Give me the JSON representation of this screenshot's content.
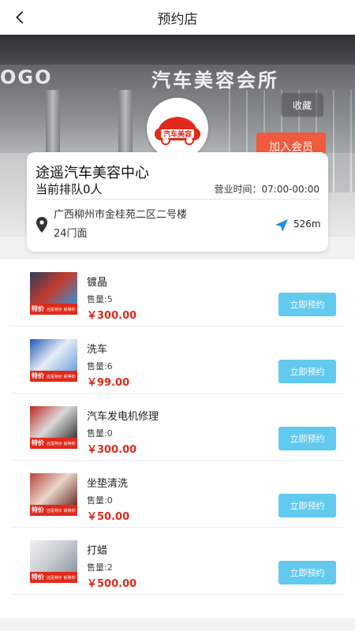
{
  "header": {
    "title": "预约店"
  },
  "banner": {
    "sign_left": "OGO",
    "sign_right": "汽车美容会所",
    "favorite_label": "收藏",
    "member_label": "加入会员",
    "logo_text": "汽车美容"
  },
  "store": {
    "name": "途遥汽车美容中心",
    "queue": "当前排队0人",
    "hours": "营业时间：07:00-00:00",
    "address": "广西柳州市金桂苑二区二号楼24门面",
    "distance": "526m"
  },
  "services": [
    {
      "name": "镀晶",
      "sales": "售量:5",
      "price": "￥300.00",
      "button": "立即预约",
      "tag": "特价",
      "tag_small": "还是特价 就等你来",
      "pic_colors": [
        "#2d3a5a",
        "#c43c2e",
        "#3a8fd0"
      ]
    },
    {
      "name": "洗车",
      "sales": "售量:6",
      "price": "￥99.00",
      "button": "立即预约",
      "tag": "特价",
      "tag_small": "还是特价 就等你来",
      "pic_colors": [
        "#2358b8",
        "#e6edf5",
        "#6fa0dc"
      ]
    },
    {
      "name": "汽车发电机修理",
      "sales": "售量:0",
      "price": "￥300.00",
      "button": "立即预约",
      "tag": "特价",
      "tag_small": "还是特价 就等你来",
      "pic_colors": [
        "#c02a22",
        "#d9d9d9",
        "#3b3b3b"
      ]
    },
    {
      "name": "坐垫清洗",
      "sales": "售量:0",
      "price": "￥50.00",
      "button": "立即预约",
      "tag": "特价",
      "tag_small": "还是特价 就等你来",
      "pic_colors": [
        "#b8453a",
        "#e8d6cc",
        "#6b3028"
      ]
    },
    {
      "name": "打蜡",
      "sales": "售量:2",
      "price": "￥500.00",
      "button": "立即预约",
      "tag": "特价",
      "tag_small": "还是特价 就等你来",
      "pic_colors": [
        "#f0f1f3",
        "#c9ced4",
        "#8e97a2"
      ]
    }
  ],
  "colors": {
    "accent": "#62c9ef",
    "price": "#e02a1b",
    "member": "#f15a3c"
  }
}
